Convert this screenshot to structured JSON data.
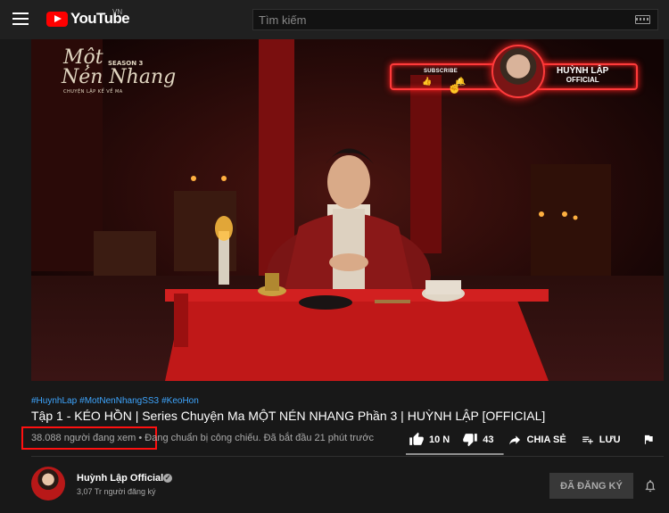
{
  "header": {
    "logo_text": "YouTube",
    "country_code": "VN",
    "search_placeholder": "Tìm kiếm"
  },
  "video_overlay": {
    "series_title_line1": "Một",
    "series_title_line2": "Nén Nhang",
    "season_label": "SEASON 3",
    "series_subtitle": "CHUYỆN LẬP KỂ VỀ MA",
    "subscribe_label": "SUBSCRIBE",
    "channel_line1": "HUỲNH LẬP",
    "channel_line2": "OFFICIAL"
  },
  "video_info": {
    "hashtags": [
      "#HuynhLap",
      "#MotNenNhangSS3",
      "#KeoHon"
    ],
    "title": "Tập 1 - KÉO HỒN | Series Chuyện Ma MỘT NÉN NHANG Phần 3 | HUỲNH LẬP [OFFICIAL]",
    "viewers": "38.088 người đang xem",
    "separator": " • ",
    "status": "Đang chuẩn bị công chiếu. Đã bắt đầu 21 phút trước"
  },
  "actions": {
    "like_count": "10 N",
    "dislike_count": "43",
    "share_label": "CHIA SẺ",
    "save_label": "LƯU",
    "like_ratio": 0.99
  },
  "channel": {
    "name": "Huỳnh Lập Official",
    "verified_mark": "✓",
    "subscribers": "3,07 Tr người đăng ký",
    "subscribe_button": "ĐÃ ĐĂNG KÝ"
  },
  "colors": {
    "background": "#181818",
    "topbar": "#202020",
    "brand_red": "#ff0000",
    "hashtag_blue": "#3ea6ff",
    "highlight_box": "#ff1010"
  },
  "icons": [
    "menu-icon",
    "youtube-logo-icon",
    "keyboard-icon",
    "thumb-up-icon",
    "thumb-down-icon",
    "share-icon",
    "playlist-add-icon",
    "flag-icon",
    "bell-icon",
    "verified-icon"
  ]
}
